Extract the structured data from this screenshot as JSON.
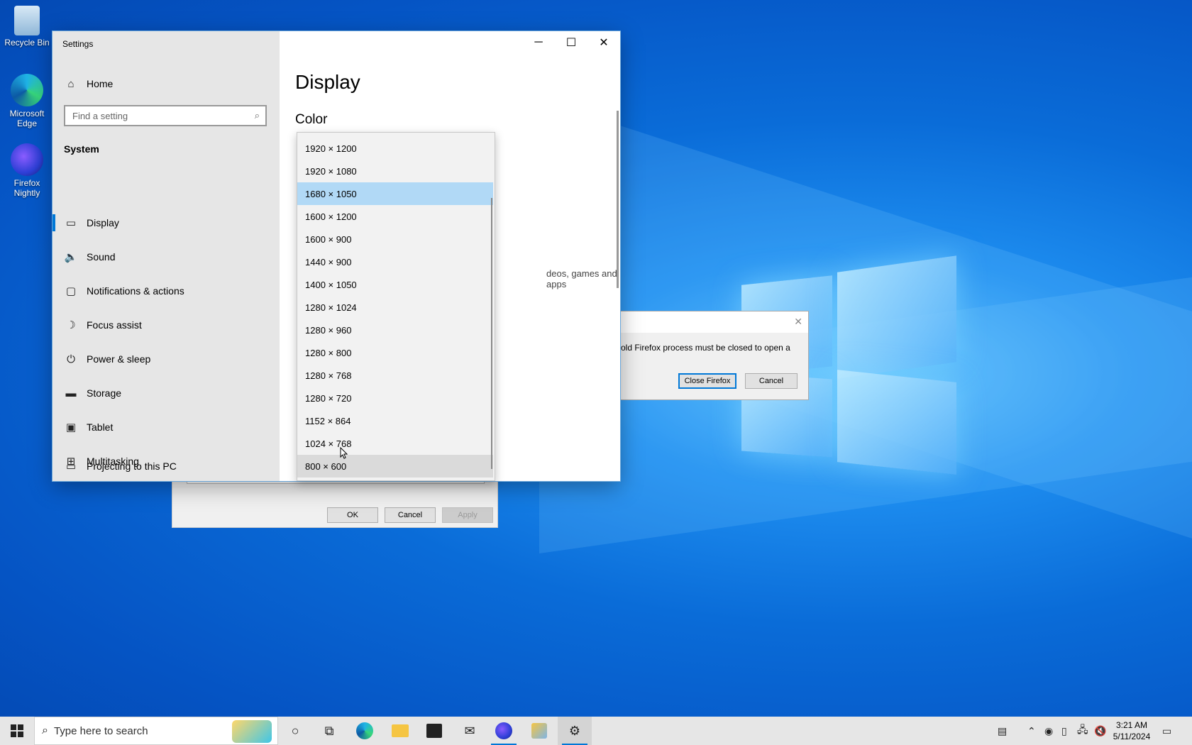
{
  "desktop": {
    "icons": [
      {
        "label_line1": "Recycle Bin",
        "label_line2": ""
      },
      {
        "label_line1": "Microsoft",
        "label_line2": "Edge"
      },
      {
        "label_line1": "Firefox",
        "label_line2": "Nightly"
      }
    ]
  },
  "settings": {
    "window_title": "Settings",
    "home_label": "Home",
    "search_placeholder": "Find a setting",
    "section_label": "System",
    "nav_items": [
      {
        "label": "Display",
        "icon": "monitor-icon"
      },
      {
        "label": "Sound",
        "icon": "speaker-icon"
      },
      {
        "label": "Notifications & actions",
        "icon": "message-icon"
      },
      {
        "label": "Focus assist",
        "icon": "moon-icon"
      },
      {
        "label": "Power & sleep",
        "icon": "power-icon"
      },
      {
        "label": "Storage",
        "icon": "storage-icon"
      },
      {
        "label": "Tablet",
        "icon": "tablet-icon"
      },
      {
        "label": "Multitasking",
        "icon": "multitasking-icon"
      },
      {
        "label": "Projecting to this PC",
        "icon": "projecting-icon"
      }
    ],
    "active_item": "Display",
    "page_title": "Display",
    "section_title": "Color",
    "partial_text": "deos, games and apps"
  },
  "resolution_dropdown": {
    "options": [
      "1920 × 1200",
      "1920 × 1080",
      "1680 × 1050",
      "1600 × 1200",
      "1600 × 900",
      "1440 × 900",
      "1400 × 1050",
      "1280 × 1024",
      "1280 × 960",
      "1280 × 800",
      "1280 × 768",
      "1280 × 720",
      "1152 × 864",
      "1024 × 768",
      "800 × 600"
    ],
    "selected": "1680 × 1050",
    "hovered": "800 × 600"
  },
  "old_dialog": {
    "ok_label": "OK",
    "cancel_label": "Cancel",
    "apply_label": "Apply"
  },
  "firefox_dialog": {
    "message": "old Firefox process must be closed to open a",
    "close_firefox_label": "Close Firefox",
    "cancel_label": "Cancel"
  },
  "taskbar": {
    "search_placeholder": "Type here to search",
    "time": "3:21 AM",
    "date": "5/11/2024"
  },
  "colors": {
    "accent": "#0078d7",
    "selected_option": "#b1d9f6",
    "sidebar_bg": "#e6e6e6"
  }
}
